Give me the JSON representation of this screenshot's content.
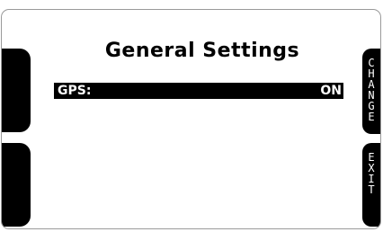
{
  "screen": {
    "title": "General Settings"
  },
  "settings": [
    {
      "label": "GPS:",
      "value": "ON"
    }
  ],
  "softkeys": {
    "right_top": "C\nH\nA\nN\nG\nE",
    "right_bottom": "E\nX\nI\nT"
  }
}
